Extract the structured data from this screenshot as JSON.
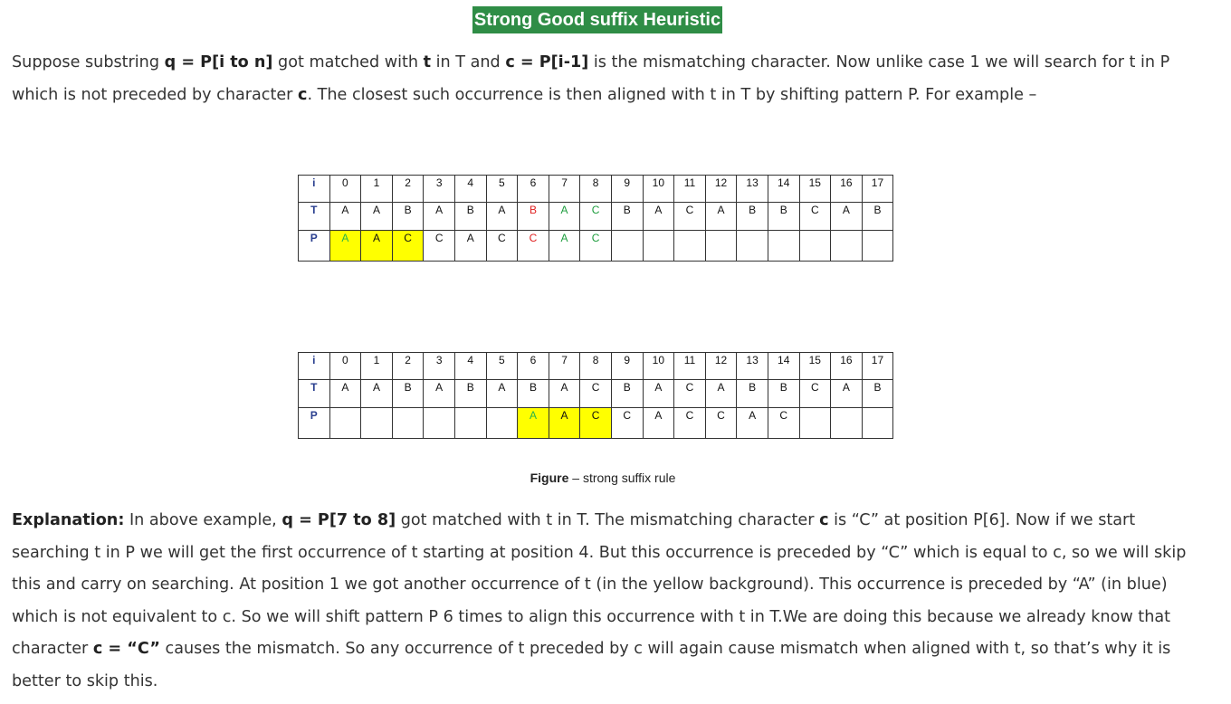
{
  "heading": "Strong Good suffix Heuristic",
  "intro": {
    "t1": "Suppose substring ",
    "b1": "q = P[i to n]",
    "t2": " got matched with ",
    "b2": "t",
    "t3": " in T and ",
    "b3": "c = P[i-1]",
    "t4": " is the mismatching character. Now unlike case 1 we will search for t in P which is not preceded by character ",
    "b4": "c",
    "t5": ". The closest such occurrence is then aligned with t in T by shifting pattern P. For example –"
  },
  "grid1": {
    "row_i_label": "i",
    "row_t_label": "T",
    "row_p_label": "P",
    "indices": [
      "0",
      "1",
      "2",
      "3",
      "4",
      "5",
      "6",
      "7",
      "8",
      "9",
      "10",
      "11",
      "12",
      "13",
      "14",
      "15",
      "16",
      "17"
    ],
    "t": [
      "A",
      "A",
      "B",
      "A",
      "B",
      "A",
      "B",
      "A",
      "C",
      "B",
      "A",
      "C",
      "A",
      "B",
      "B",
      "C",
      "A",
      "B"
    ],
    "p": [
      "A",
      "A",
      "C",
      "C",
      "A",
      "C",
      "C",
      "A",
      "C",
      "",
      "",
      "",
      "",
      "",
      "",
      "",
      "",
      ""
    ]
  },
  "grid2": {
    "row_i_label": "i",
    "row_t_label": "T",
    "row_p_label": "P",
    "indices": [
      "0",
      "1",
      "2",
      "3",
      "4",
      "5",
      "6",
      "7",
      "8",
      "9",
      "10",
      "11",
      "12",
      "13",
      "14",
      "15",
      "16",
      "17"
    ],
    "t": [
      "A",
      "A",
      "B",
      "A",
      "B",
      "A",
      "B",
      "A",
      "C",
      "B",
      "A",
      "C",
      "A",
      "B",
      "B",
      "C",
      "A",
      "B"
    ],
    "p": [
      "",
      "",
      "",
      "",
      "",
      "",
      "A",
      "A",
      "C",
      "C",
      "A",
      "C",
      "C",
      "A",
      "C",
      "",
      "",
      ""
    ]
  },
  "caption": {
    "bold": "Figure",
    "rest": " – strong suffix rule"
  },
  "explanation": {
    "label": "Explanation:",
    "t1": " In above example, ",
    "b1": "q = P[7 to 8]",
    "t2": " got matched with t in T. The mismatching character ",
    "b2": "c",
    "t3": " is “C” at position P[6]. Now if we start searching t in P we will get the first occurrence of t starting at position 4. But this occurrence is preceded by “C” which is equal to c, so we will skip this and carry on searching. At position 1 we got another occurrence of t (in the yellow background). This occurrence is preceded by “A” (in blue) which is not equivalent to c. So we will shift pattern P 6 times to align this occurrence with t in T.We are doing this because we already know that character ",
    "b3": "c = “C”",
    "t4": " causes the mismatch. So any occurrence of t preceded by c will again cause mismatch when aligned with t, so that’s why it is better to skip this."
  },
  "colors": {
    "heading_bg": "#2f8d46",
    "highlight": "#ffff00",
    "match_green": "#29b34a",
    "mismatch_red": "#e02020"
  }
}
